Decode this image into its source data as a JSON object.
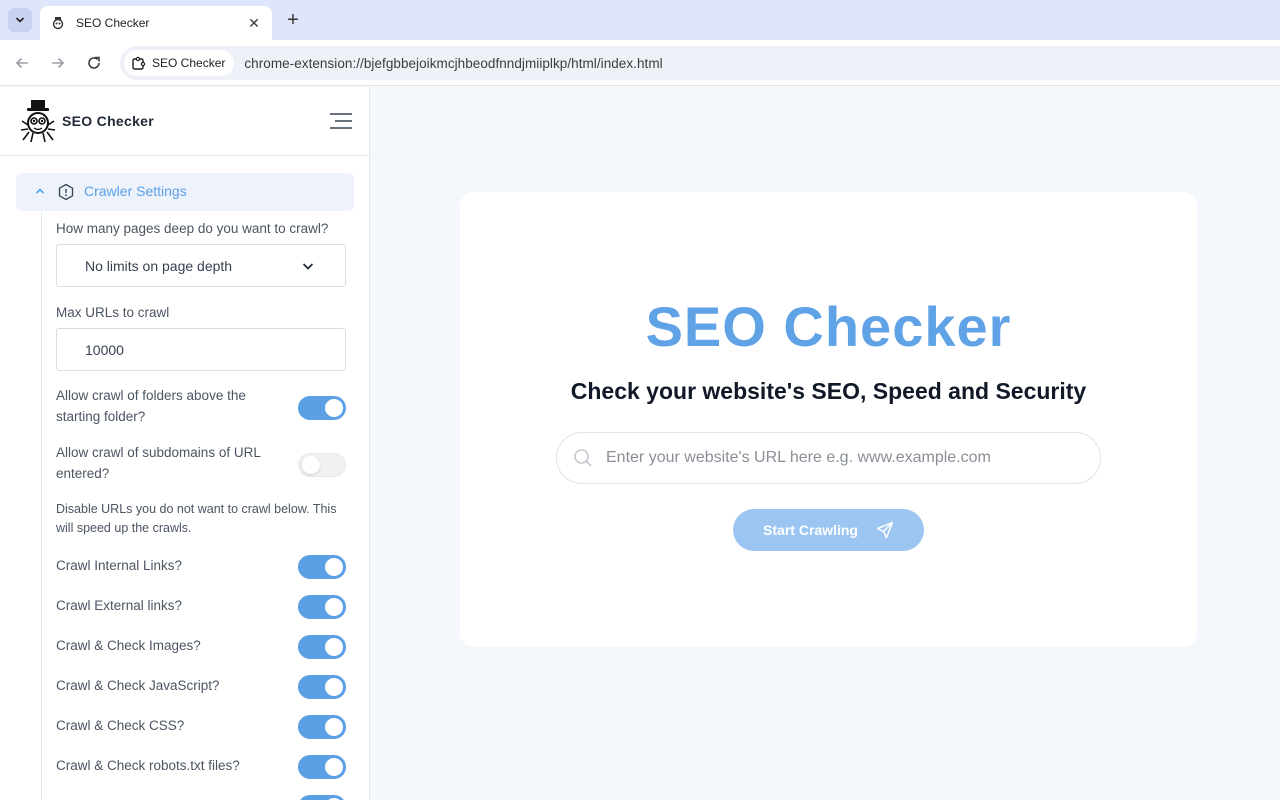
{
  "browser": {
    "tab_title": "SEO Checker",
    "new_tab_symbol": "+",
    "close_symbol": "✕",
    "site_chip_label": "SEO Checker",
    "url": "chrome-extension://bjefgbbejoikmcjhbeodfnndjmiiplkp/html/index.html"
  },
  "sidebar": {
    "brand_name": "SEO Checker",
    "section_title": "Crawler Settings",
    "depth_label": "How many pages deep do you want to crawl?",
    "depth_value": "No limits on page depth",
    "max_urls_label": "Max URLs to crawl",
    "max_urls_value": "10000",
    "folders_label": "Allow crawl of folders above the starting folder?",
    "folders_on": true,
    "subdomains_label": "Allow crawl of subdomains of URL entered?",
    "subdomains_on": false,
    "disable_note": "Disable URLs you do not want to crawl below. This will speed up the crawls.",
    "toggles": [
      {
        "label": "Crawl Internal Links?",
        "on": true
      },
      {
        "label": "Crawl External links?",
        "on": true
      },
      {
        "label": "Crawl & Check Images?",
        "on": true
      },
      {
        "label": "Crawl & Check JavaScript?",
        "on": true
      },
      {
        "label": "Crawl & Check CSS?",
        "on": true
      },
      {
        "label": "Crawl & Check robots.txt files?",
        "on": true
      }
    ]
  },
  "main": {
    "title": "SEO Checker",
    "subtitle": "Check your website's SEO, Speed and Security",
    "search_placeholder": "Enter your website's URL here e.g. www.example.com",
    "start_button": "Start Crawling"
  },
  "colors": {
    "accent": "#5fa2e6",
    "toggle_on": "#5b9fe4",
    "button_disabled": "#9cc5f2"
  }
}
